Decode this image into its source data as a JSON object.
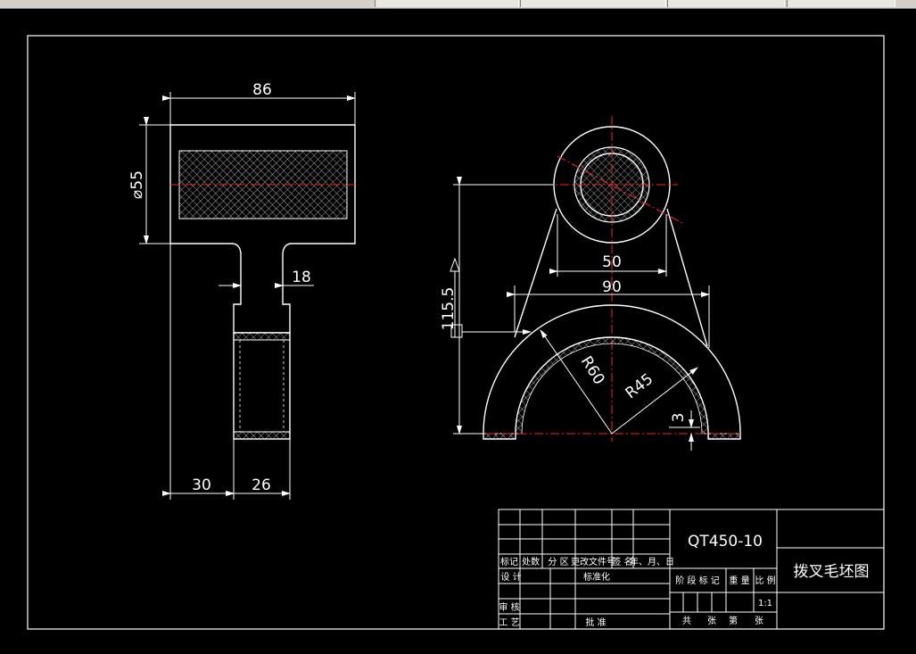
{
  "toolbar": {
    "tab1": "",
    "tab2": "",
    "tab3": "",
    "tab4": ""
  },
  "drawing": {
    "dims": {
      "width_total": "86",
      "diameter": "⌀55",
      "stem_width": "18",
      "bottom_left": "30",
      "bottom_right": "26",
      "height": "115.5",
      "chord_inner": "50",
      "chord_outer": "90",
      "radius_outer": "R60",
      "radius_inner": "R45",
      "thickness": "3"
    },
    "title_block": {
      "material": "QT450-10",
      "title": "拨叉毛坯图",
      "scale_value": "1:1",
      "labels": {
        "mark": "标记",
        "count": "处数",
        "zone": "分 区",
        "change_doc": "更改文件号",
        "sign": "签 名",
        "date": "年、月、日",
        "design": "设 计",
        "standardize": "标准化",
        "stage_mark": "阶 段 标 记",
        "weight": "重 量",
        "scale": "比 例",
        "review": "审 核",
        "process": "工 艺",
        "approve": "批 准",
        "total": "共",
        "sheets": "张",
        "sheet_no": "第",
        "sheet": "张"
      }
    },
    "colors": {
      "background": "#000000",
      "line": "#ffffff",
      "centerline": "#ff2020"
    }
  }
}
